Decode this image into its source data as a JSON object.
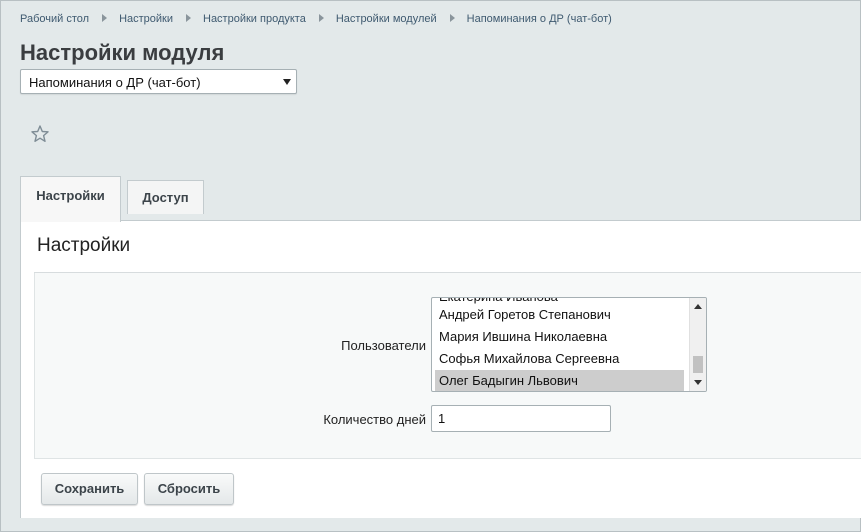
{
  "breadcrumb": [
    "Рабочий стол",
    "Настройки",
    "Настройки продукта",
    "Настройки модулей",
    "Напоминания о ДР (чат-бот)"
  ],
  "page": {
    "title": "Настройки модуля"
  },
  "module_select": {
    "value": "Напоминания о ДР (чат-бот)"
  },
  "toolbar": {
    "favorite_icon": "star-icon"
  },
  "tabs": [
    {
      "label": "Настройки",
      "active": true
    },
    {
      "label": "Доступ",
      "active": false
    }
  ],
  "panel": {
    "title": "Настройки"
  },
  "form": {
    "users_label": "Пользователи",
    "users_options": [
      {
        "label": "Андрей Горетов Степанович",
        "selected": false
      },
      {
        "label": "Мария Ившина Николаевна",
        "selected": false
      },
      {
        "label": "Софья Михайлова Сергеевна",
        "selected": false
      },
      {
        "label": "Олег Бадыгин Львович",
        "selected": true
      }
    ],
    "users_option_partial": "Екатерина Иванова",
    "days_label": "Количество дней",
    "days_value": "1"
  },
  "buttons": {
    "save_label": "Сохранить",
    "reset_label": "Сбросить"
  },
  "colors": {
    "background": "#e3e9ea",
    "selected_option": "#cdcdcd",
    "breadcrumb_text": "#3f5a70"
  }
}
